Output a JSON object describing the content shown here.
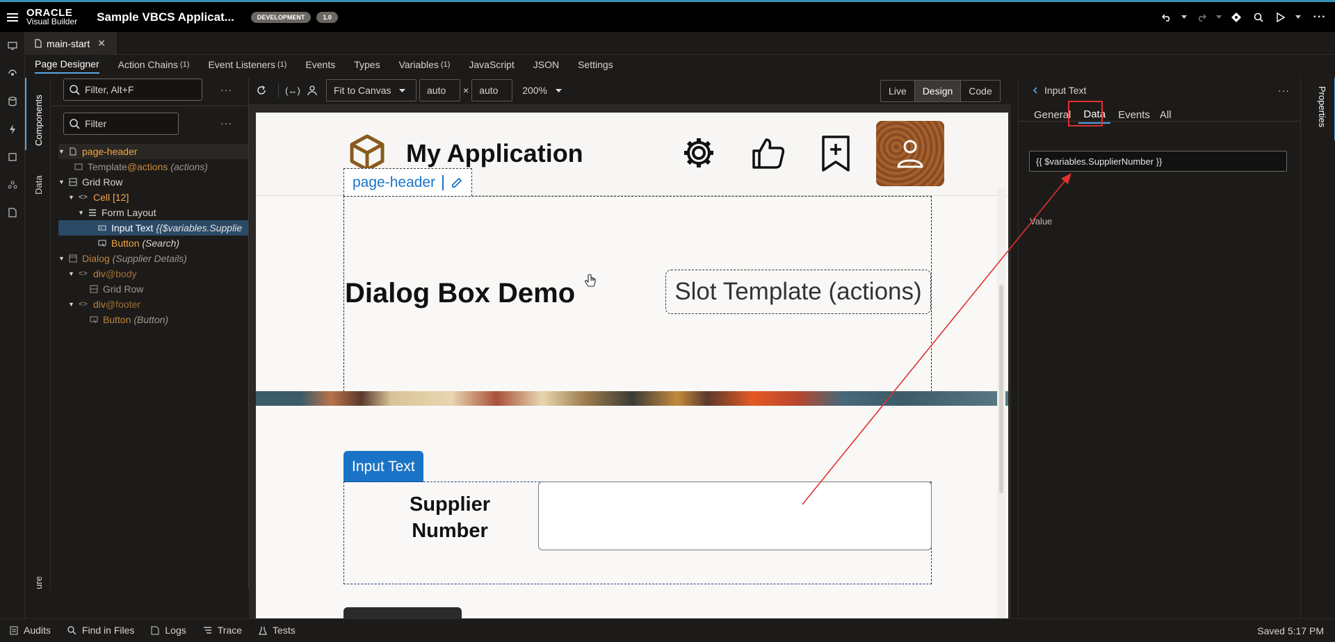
{
  "topbar": {
    "brand_line1": "ORACLE",
    "brand_line2": "Visual Builder",
    "app_title": "Sample VBCS Applicat...",
    "env_badge": "DEVELOPMENT",
    "version_badge": "1.0"
  },
  "file_tab": {
    "label": "main-start"
  },
  "designer_tabs": [
    {
      "label": "Page Designer",
      "count": ""
    },
    {
      "label": "Action Chains",
      "count": "(1)"
    },
    {
      "label": "Event Listeners",
      "count": "(1)"
    },
    {
      "label": "Events",
      "count": ""
    },
    {
      "label": "Types",
      "count": ""
    },
    {
      "label": "Variables",
      "count": "(1)"
    },
    {
      "label": "JavaScript",
      "count": ""
    },
    {
      "label": "JSON",
      "count": ""
    },
    {
      "label": "Settings",
      "count": ""
    }
  ],
  "side_tabs": {
    "components": "Components",
    "data": "Data",
    "structure": "ure"
  },
  "filter1": {
    "placeholder": "Filter, Alt+F"
  },
  "filter2": {
    "placeholder": "Filter"
  },
  "tree": {
    "page_header": "page-header",
    "template": "Template",
    "template_slot": "@actions",
    "template_hint": "(actions)",
    "grid_row": "Grid Row",
    "cell": "Cell [12]",
    "form_layout": "Form Layout",
    "input_text": "Input Text",
    "input_text_hint": "{{$variables.Supplie",
    "button": "Button",
    "button_hint": "(Search)",
    "dialog": "Dialog",
    "dialog_hint": "(Supplier Details)",
    "div_body": "div",
    "div_body_slot": "@body",
    "grid_row2": "Grid Row",
    "div_footer": "div",
    "div_footer_slot": "@footer",
    "button2": "Button",
    "button2_hint": "(Button)"
  },
  "canvas_toolbar": {
    "fit": "Fit to Canvas",
    "width": "auto",
    "x": "×",
    "height": "auto",
    "zoom": "200%",
    "modes": [
      "Live",
      "Design",
      "Code"
    ],
    "active_mode": "Design"
  },
  "canvas": {
    "app_name": "My Application",
    "header_tag": "page-header",
    "dialog_title": "Dialog Box Demo",
    "slot_label": "Slot Template (actions)",
    "input_tag": "Input Text",
    "supplier_label_1": "Supplier",
    "supplier_label_2": "Number"
  },
  "properties": {
    "back_title": "Input Text",
    "tabs": [
      "General",
      "Data",
      "Events",
      "All"
    ],
    "active_tab": "Data",
    "value_label": "Value",
    "value": "{{ $variables.SupplierNumber }}",
    "vertical_label": "Properties"
  },
  "statusbar": {
    "items": [
      "Audits",
      "Find in Files",
      "Logs",
      "Trace",
      "Tests"
    ],
    "saved": "Saved 5:17 PM"
  },
  "colors": {
    "accent": "#1a73c6",
    "highlight_box": "#e23030",
    "arrow": "#e23030",
    "tree_orange": "#f0a646"
  }
}
